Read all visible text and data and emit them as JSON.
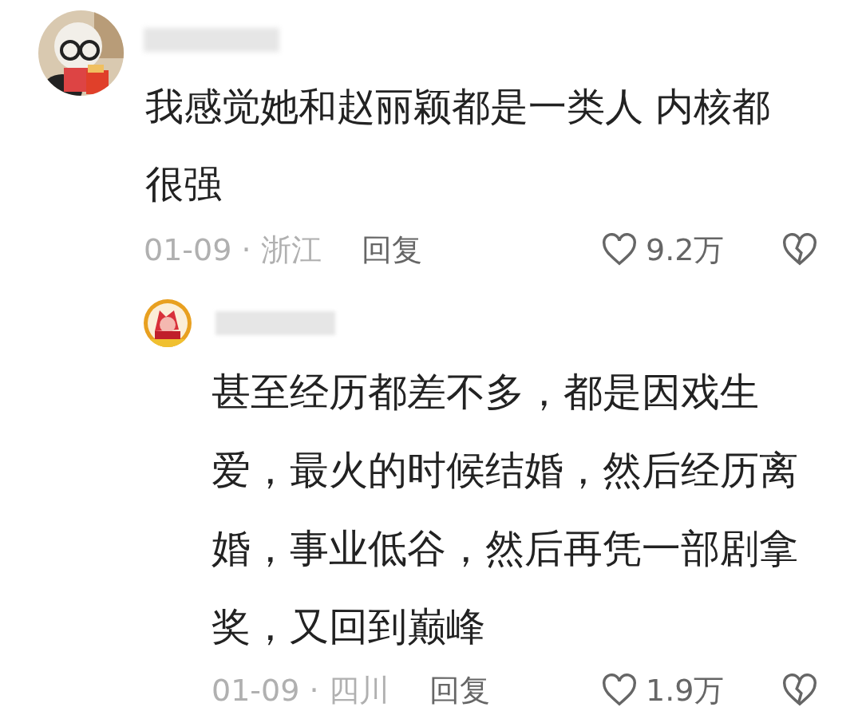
{
  "comments": [
    {
      "text": "我感觉她和赵丽颖都是一类人 内核都很强",
      "meta": "01-09 · 浙江",
      "reply_label": "回复",
      "likes": "9.2万",
      "replies": [
        {
          "text": "甚至经历都差不多，都是因戏生爱，最火的时候结婚，然后经历离婚，事业低谷，然后再凭一部剧拿奖，又回到巅峰",
          "meta": "01-09 · 四川",
          "reply_label": "回复",
          "likes": "1.9万"
        }
      ]
    }
  ]
}
